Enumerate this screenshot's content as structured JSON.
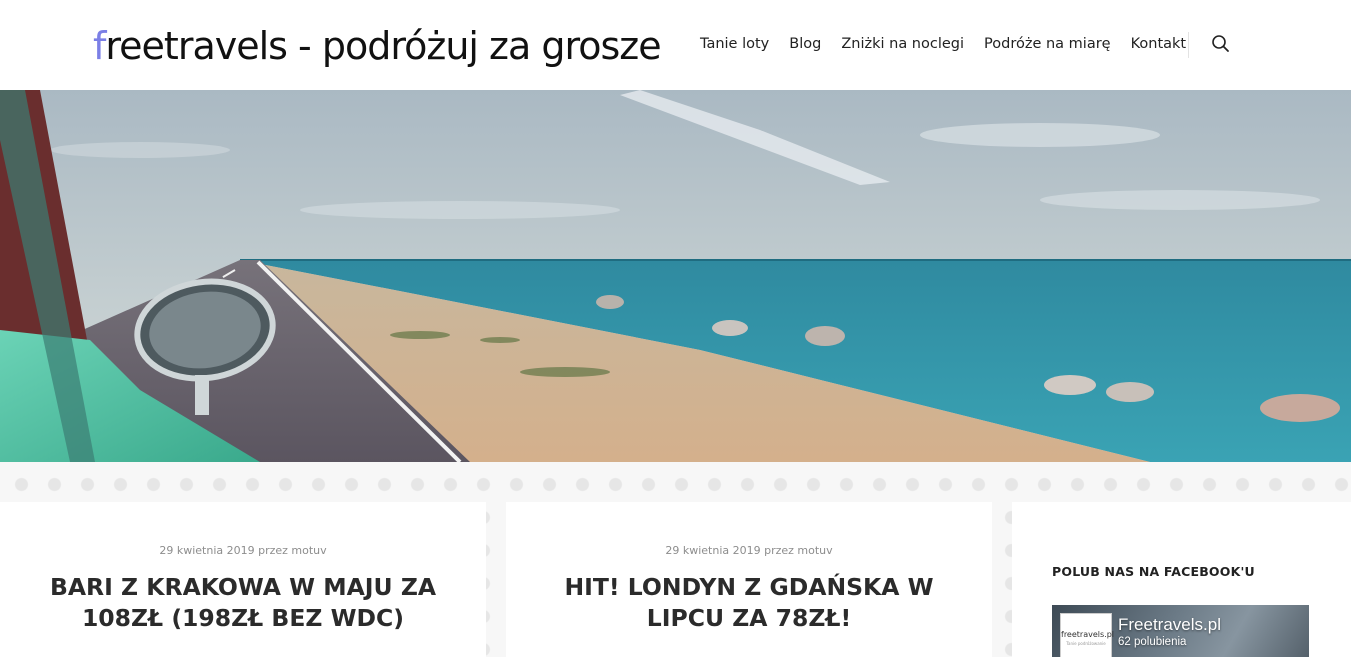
{
  "header": {
    "logo_first": "f",
    "logo_rest": "reetravels - podróżuj za grosze",
    "nav": [
      "Tanie loty",
      "Blog",
      "Zniżki na noclegi",
      "Podróże na miarę",
      "Kontakt"
    ],
    "search_icon": "search-icon"
  },
  "hero": {
    "image": "seaside-road-car-mirror"
  },
  "posts": [
    {
      "meta": "29 kwietnia 2019 przez motuv",
      "title": "BARI Z KRAKOWA W MAJU ZA 108ZŁ (198ZŁ BEZ WDC)"
    },
    {
      "meta": "29 kwietnia 2019 przez motuv",
      "title": "HIT! LONDYN Z GDAŃSKA W LIPCU ZA 78ZŁ!"
    }
  ],
  "sidebar": {
    "widget_title": "POLUB NAS NA FACEBOOK'U",
    "fb_page_name": "Freetravels.pl",
    "fb_likes": "62 polubienia",
    "fb_logo_text": "freetravels.pl",
    "fb_logo_sub": "Tanie podróżowanie"
  },
  "colors": {
    "accent": "#7b7fe6",
    "text": "#2b2b2b",
    "meta": "#8d8d8d"
  }
}
